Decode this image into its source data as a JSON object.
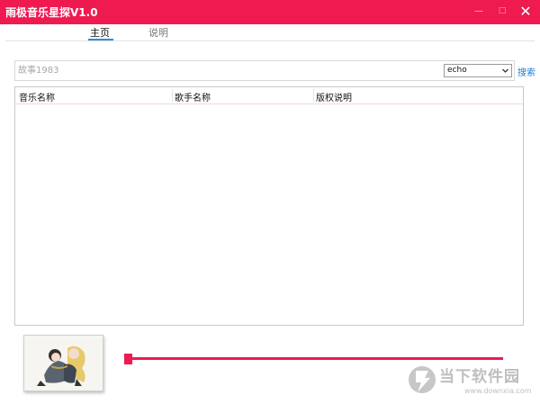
{
  "window": {
    "title": "雨极音乐星探V1.0",
    "minimize_glyph": "—",
    "maximize_glyph": "□",
    "close_glyph": "✕"
  },
  "tabs": [
    {
      "label": "主页",
      "active": true
    },
    {
      "label": "说明",
      "active": false
    }
  ],
  "search": {
    "value": "",
    "placeholder": "故事1983",
    "source_selected": "echo",
    "button_label": "搜索"
  },
  "results_table": {
    "columns": [
      "音乐名称",
      "歌手名称",
      "版权说明"
    ],
    "rows": []
  },
  "player": {
    "progress": 0.0
  },
  "watermark": {
    "name": "当下软件园",
    "url": "www.downxia.com"
  },
  "colors": {
    "accent": "#ee1a50",
    "tab_underline": "#2b8fd6",
    "link": "#1a7fd6"
  }
}
